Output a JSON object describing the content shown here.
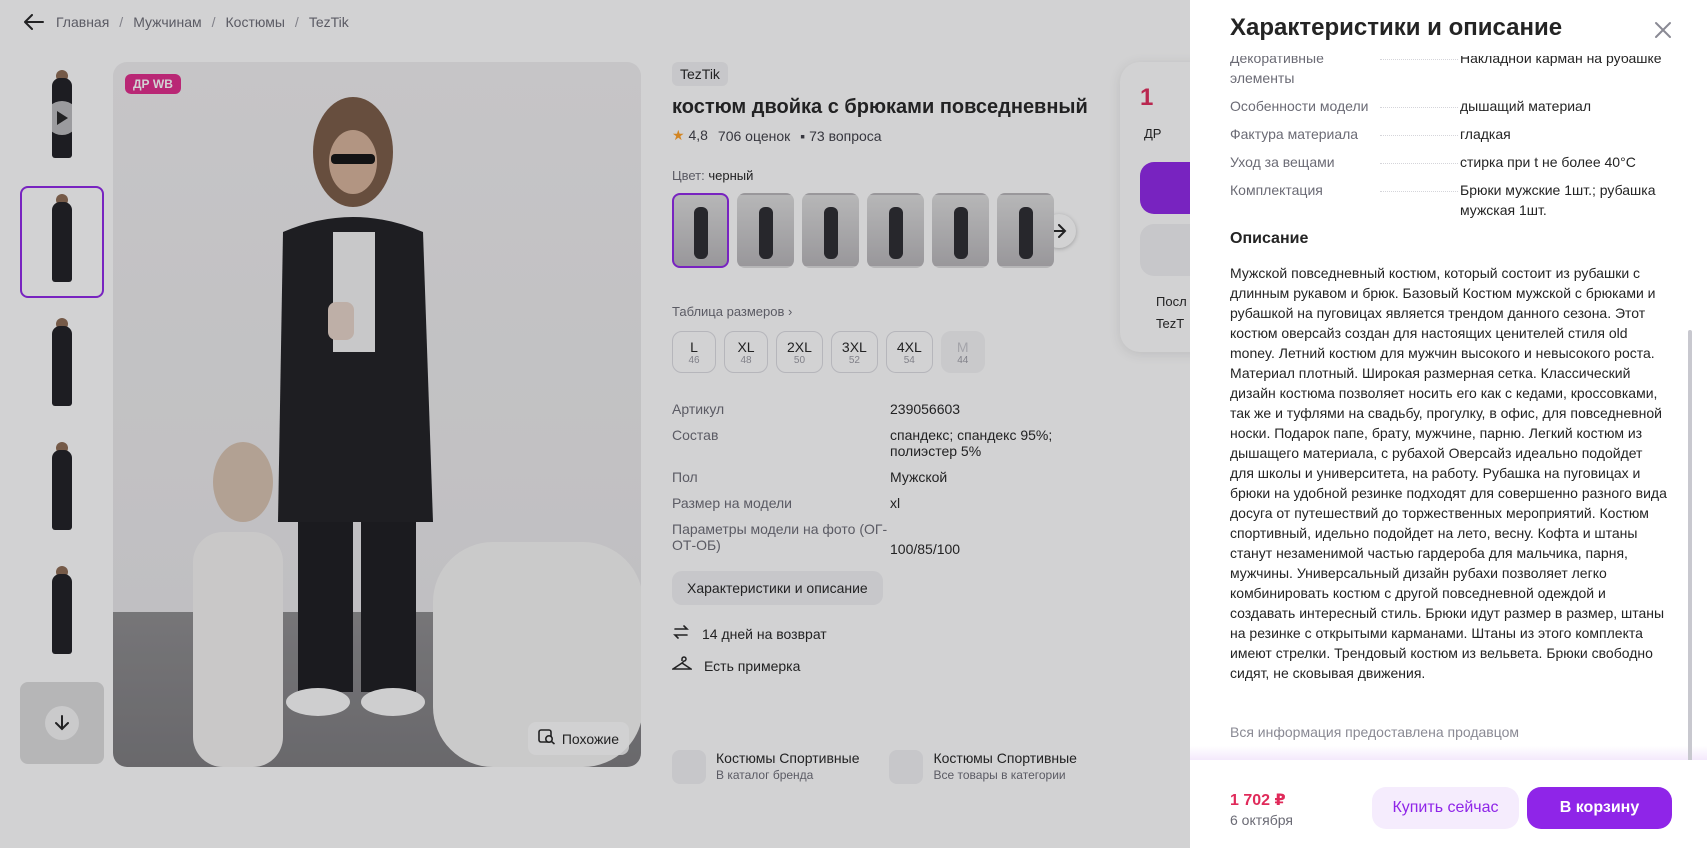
{
  "breadcrumbs": [
    "Главная",
    "Мужчинам",
    "Костюмы",
    "TezTik"
  ],
  "gallery": {
    "badge": "ДР WB",
    "similar_label": "Похожие"
  },
  "product": {
    "brand": "TezTik",
    "title": "костюм двойка с брюками повседневный",
    "rating": "4,8",
    "reviews": "706 оценок",
    "questions": "73 вопроса",
    "color_label": "Цвет:",
    "color_value": "черный",
    "size_table": "Таблица размеров",
    "sizes": [
      {
        "label": "L",
        "ru": "46"
      },
      {
        "label": "XL",
        "ru": "48"
      },
      {
        "label": "2XL",
        "ru": "50"
      },
      {
        "label": "3XL",
        "ru": "52"
      },
      {
        "label": "4XL",
        "ru": "54"
      },
      {
        "label": "M",
        "ru": "44"
      }
    ],
    "params": [
      {
        "k": "Артикул",
        "v": "239056603"
      },
      {
        "k": "Состав",
        "v": "спандекс; спандекс 95%; полиэстер 5%"
      },
      {
        "k": "Пол",
        "v": "Мужской"
      },
      {
        "k": "Размер на модели",
        "v": "xl"
      },
      {
        "k": "Параметры модели на фото (ОГ-ОТ-ОБ)",
        "v": "100/85/100"
      }
    ],
    "chars_button": "Характеристики и описание",
    "return_text": "14 дней на возврат",
    "fitting_text": "Есть примерка",
    "link1_title": "Костюмы Спортивные",
    "link1_sub": "В каталог бренда",
    "link2_title": "Костюмы Спортивные",
    "link2_sub": "Все товары в категории"
  },
  "price_card": {
    "price_partial": "1",
    "badge_partial": "ДР",
    "delivery_partial": "Посл",
    "seller_partial": "TezT"
  },
  "panel": {
    "title": "Характеристики и описание",
    "characteristics": [
      {
        "k": "Декоративные элементы",
        "v": "Накладной карман на рубашке"
      },
      {
        "k": "Особенности модели",
        "v": "дышащий материал"
      },
      {
        "k": "Фактура материала",
        "v": "гладкая"
      },
      {
        "k": "Уход за вещами",
        "v": "стирка при t не более 40°C"
      },
      {
        "k": "Комплектация",
        "v": "Брюки мужские 1шт.; рубашка мужская 1шт."
      }
    ],
    "description_title": "Описание",
    "description": "Мужской повседневный костюм, который состоит из рубашки с длинным рукавом и брюк. Базовый Костюм мужской с брюками и рубашкой на пуговицах является трендом данного сезона. Этот костюм оверсайз создан для настоящих ценителей стиля old money. Летний костюм для мужчин высокого и невысокого роста. Материал плотный. Широкая размерная сетка. Классический дизайн костюма позволяет носить его как с кедами, кроссовками, так же и туфлями на свадьбу, прогулку, в офис, для повседневной носки. Подарок папе, брату, мужчине, парню. Легкий костюм из дышащего материала, с рубахой Оверсайз идеально подойдет для школы и университета, на работу. Рубашка на пуговицах и брюки на удобной резинке подходят для совершенно разного вида досуга от путешествий до торжественных мероприятий. Костюм спортивный, идельно подойдет на лето, весну. Кофта и штаны станут незаменимой частью гардероба для мальчика, парня, мужчины. Универсальный дизайн рубахи позволяет легко комбинировать костюм с другой повседневной одеждой и создавать интересный стиль. Брюки идут размер в размер, штаны на резинке с открытыми карманами. Штаны из этого комплекта имеют стрелки. Трендовый костюм из вельвета. Брюки свободно сидят, не сковывая движения.",
    "seller_note": "Вся информация предоставлена продавцом",
    "footer_price": "1 702 ₽",
    "footer_date": "6 октября",
    "buy_now": "Купить сейчас",
    "to_cart": "В корзину"
  },
  "colors": {
    "accent": "#8f25e8",
    "price": "#e02a5a",
    "badge": "#e02a8a",
    "star": "#ff9f24"
  }
}
